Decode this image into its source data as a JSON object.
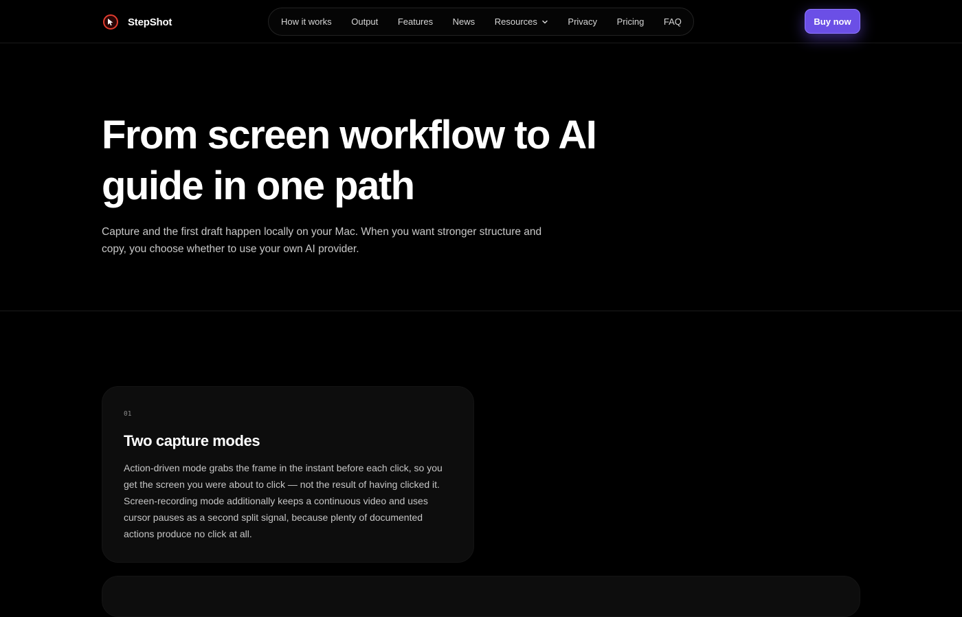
{
  "brand": {
    "name": "StepShot",
    "logo_icon": "cursor-icon",
    "accent_color": "#e23b2e"
  },
  "nav": {
    "items": [
      {
        "label": "How it works"
      },
      {
        "label": "Output"
      },
      {
        "label": "Features"
      },
      {
        "label": "News"
      },
      {
        "label": "Resources",
        "icon": "chevron-down-icon"
      },
      {
        "label": "Privacy"
      },
      {
        "label": "Pricing"
      },
      {
        "label": "FAQ"
      }
    ]
  },
  "cta": {
    "label": "Buy now",
    "color": "#6b4fe6"
  },
  "hero": {
    "title": "From screen workflow to AI guide in one path",
    "subtitle": "Capture and the first draft happen locally on your Mac. When you want stronger structure and copy, you choose whether to use your own AI provider."
  },
  "cards": [
    {
      "number": "01",
      "title": "Two capture modes",
      "body": "Action-driven mode grabs the frame in the instant before each click, so you get the screen you were about to click — not the result of having clicked it. Screen-recording mode additionally keeps a continuous video and uses cursor pauses as a second split signal, because plenty of documented actions produce no click at all."
    }
  ]
}
